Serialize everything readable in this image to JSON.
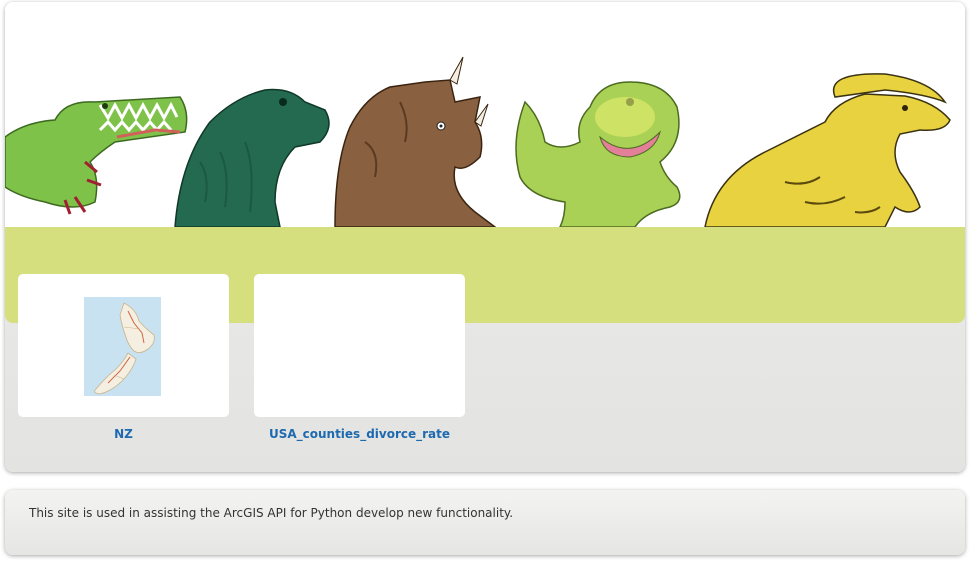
{
  "banner": {
    "image_icon": "dinosaur-illustrations-icon"
  },
  "gallery": {
    "items": [
      {
        "title": "NZ",
        "thumbnail_icon": "new-zealand-map-icon"
      },
      {
        "title": "USA_counties_divorce_rate",
        "thumbnail_icon": ""
      }
    ]
  },
  "footer": {
    "text": "This site is used in assisting the ArcGIS API for Python develop new functionality."
  },
  "colors": {
    "accent_band": "#d5df7e",
    "link": "#1d6ab0",
    "panel_bg": "#e9e9e7"
  }
}
